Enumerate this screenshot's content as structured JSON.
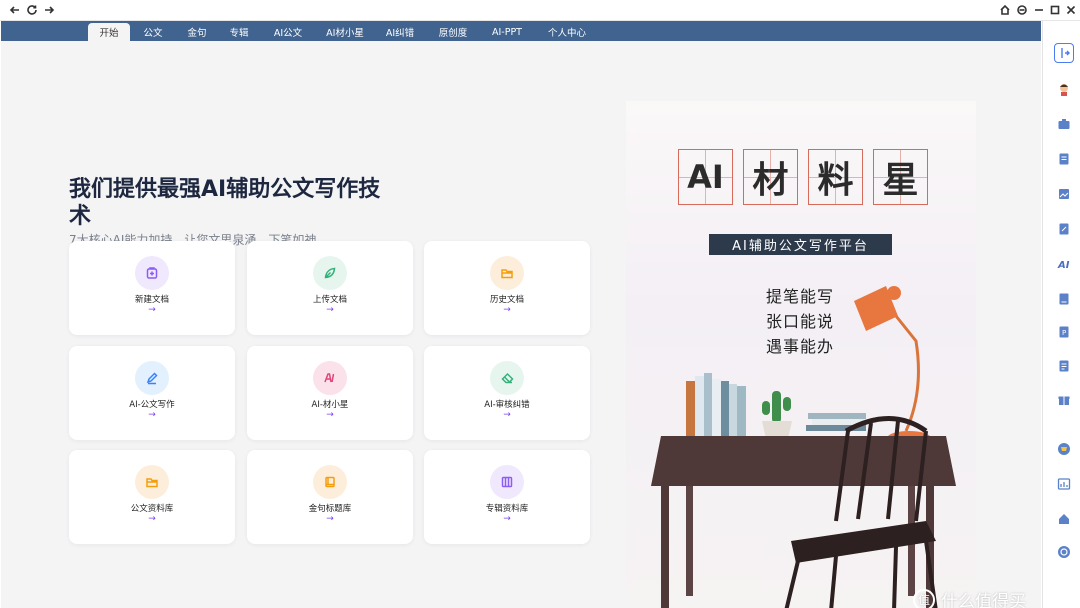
{
  "browser": {
    "icons": [
      "back-icon",
      "refresh-icon",
      "forward-icon",
      "home-icon",
      "network-icon",
      "minimize-icon",
      "maximize-icon",
      "close-icon"
    ]
  },
  "nav": {
    "tabs": [
      {
        "label": "开始",
        "active": true
      },
      {
        "label": "公文"
      },
      {
        "label": "金句"
      },
      {
        "label": "专辑"
      },
      {
        "label": "AI公文"
      },
      {
        "label": "AI材小星"
      },
      {
        "label": "AI纠错"
      },
      {
        "label": "原创度"
      },
      {
        "label": "AI-PPT"
      },
      {
        "label": "个人中心"
      }
    ]
  },
  "hero": {
    "title": "我们提供最强AI辅助公文写作技术",
    "subtitle": "7大核心AI能力加持，让您文思泉涌，下笔如神"
  },
  "cards": [
    {
      "label": "新建文档",
      "arrow": "→",
      "icon": "file-plus-icon",
      "color": "#8b5cf6",
      "bg": "#f0e8fd"
    },
    {
      "label": "上传文档",
      "arrow": "→",
      "icon": "leaf-icon",
      "color": "#34b27b",
      "bg": "#e6f6ef"
    },
    {
      "label": "历史文档",
      "arrow": "→",
      "icon": "folder-open-icon",
      "color": "#f59e0b",
      "bg": "#fdeedc"
    },
    {
      "label": "AI-公文写作",
      "arrow": "→",
      "icon": "pen-icon",
      "color": "#3b82f6",
      "bg": "#e3f0fd"
    },
    {
      "label": "AI-材小星",
      "arrow": "→",
      "icon": "ai-icon",
      "color": "#e0457b",
      "bg": "#fbe1e9"
    },
    {
      "label": "AI-审核纠错",
      "arrow": "→",
      "icon": "eraser-icon",
      "color": "#34b27b",
      "bg": "#e6f6ef"
    },
    {
      "label": "公文资料库",
      "arrow": "→",
      "icon": "folder-open-icon",
      "color": "#f59e0b",
      "bg": "#fdeedc"
    },
    {
      "label": "金句标题库",
      "arrow": "→",
      "icon": "book-icon",
      "color": "#f59e0b",
      "bg": "#fdeedc"
    },
    {
      "label": "专辑资料库",
      "arrow": "→",
      "icon": "columns-icon",
      "color": "#8b5cf6",
      "bg": "#f0e8fd"
    }
  ],
  "poster": {
    "chars": [
      "AI",
      "材",
      "料",
      "星"
    ],
    "banner": "AI辅助公文写作平台",
    "slogans": [
      "提笔能写",
      "张口能说",
      "遇事能办"
    ]
  },
  "sidebar": {
    "icons": [
      "sidebar-toggle-icon",
      "avatar-icon",
      "briefcase-icon",
      "document-icon",
      "image-icon",
      "write-icon",
      "ai-icon",
      "book-icon",
      "p-icon",
      "list-icon",
      "gift-icon",
      "cart-icon",
      "chart-icon",
      "home-icon",
      "power-icon"
    ]
  },
  "watermark": {
    "text": "什么值得买",
    "icon": "zhi-logo-icon"
  }
}
